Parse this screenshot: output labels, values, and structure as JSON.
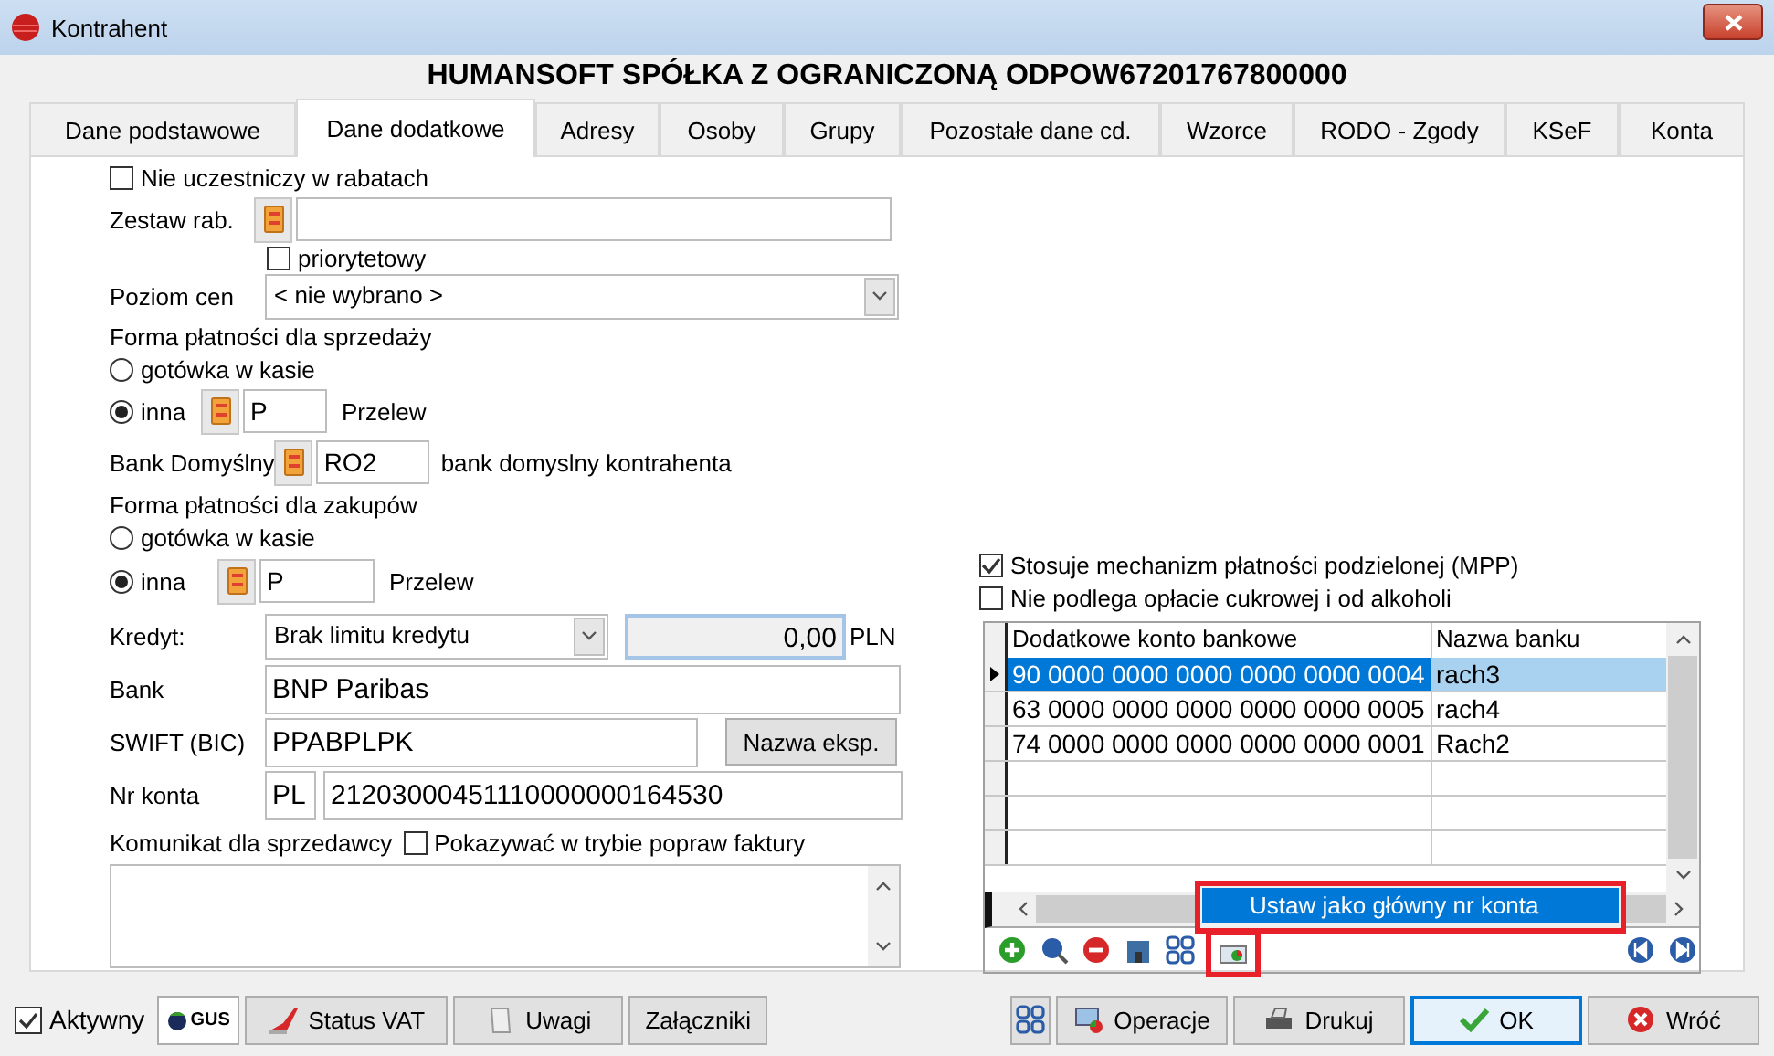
{
  "window": {
    "title": "Kontrahent"
  },
  "heading": "HUMANSOFT SPÓŁKA Z OGRANICZONĄ ODPOW67201767800000",
  "tabs": [
    {
      "label": "Dane podstawowe",
      "selected": false
    },
    {
      "label": "Dane dodatkowe",
      "selected": true
    },
    {
      "label": "Adresy",
      "selected": false
    },
    {
      "label": "Osoby",
      "selected": false
    },
    {
      "label": "Grupy",
      "selected": false
    },
    {
      "label": "Pozostałe dane cd.",
      "selected": false
    },
    {
      "label": "Wzorce",
      "selected": false
    },
    {
      "label": "RODO - Zgody",
      "selected": false
    },
    {
      "label": "KSeF",
      "selected": false
    },
    {
      "label": "Konta",
      "selected": false
    }
  ],
  "discount": {
    "exclude": {
      "label": "Nie uczestniczy w rabatach",
      "checked": false
    },
    "set_label": "Zestaw rab.",
    "priority": {
      "label": "priorytetowy",
      "checked": false
    }
  },
  "price_level": {
    "label": "Poziom cen",
    "value": "< nie wybrano >"
  },
  "sales_payment": {
    "title": "Forma płatności dla sprzedaży",
    "options": [
      {
        "label": "gotówka w kasie",
        "selected": false
      },
      {
        "label": "inna",
        "selected": true
      }
    ],
    "code": "P",
    "name": "Przelew"
  },
  "default_bank": {
    "label": "Bank Domyślny",
    "code": "RO2",
    "description": "bank domyslny kontrahenta"
  },
  "purchase_payment": {
    "title": "Forma płatności dla zakupów",
    "options": [
      {
        "label": "gotówka w kasie",
        "selected": false
      },
      {
        "label": "inna",
        "selected": true
      }
    ],
    "code": "P",
    "name": "Przelew"
  },
  "credit": {
    "label": "Kredyt:",
    "value": "Brak limitu kredytu",
    "amount": "0,00",
    "currency": "PLN"
  },
  "bank": {
    "label": "Bank",
    "value": "BNP Paribas"
  },
  "swift": {
    "label": "SWIFT (BIC)",
    "value": "PPABPLPK",
    "button": "Nazwa eksp."
  },
  "account": {
    "label": "Nr konta",
    "country": "PL",
    "number": "21203000451110000000164530"
  },
  "message": {
    "label": "Komunikat dla sprzedawcy",
    "show_in_correction": {
      "label": "Pokazywać w trybie popraw faktury",
      "checked": false
    }
  },
  "options": [
    {
      "label": "Stosuje mechanizm płatności podzielonej (MPP)",
      "checked": true
    },
    {
      "label": "Nie podlega opłacie cukrowej i od alkoholi",
      "checked": false
    }
  ],
  "accounts_table": {
    "columns": [
      "Dodatkowe konto bankowe",
      "Nazwa banku"
    ],
    "rows": [
      {
        "account": "90 0000 0000 0000 0000 0000 0004",
        "bank": "rach3",
        "selected": true
      },
      {
        "account": "63 0000 0000 0000 0000 0000 0005",
        "bank": "rach4",
        "selected": false
      },
      {
        "account": "74 0000 0000 0000 0000 0000 0001",
        "bank": "Rach2",
        "selected": false
      }
    ]
  },
  "context_menu": {
    "items": [
      "Ustaw jako główny nr konta"
    ]
  },
  "bottom_bar": {
    "active": {
      "label": "Aktywny",
      "checked": true
    },
    "left_buttons": [
      {
        "kind": "gus",
        "label": "GUS"
      },
      {
        "kind": "vat",
        "label": "Status VAT"
      },
      {
        "kind": "notes",
        "label": "Uwagi"
      },
      {
        "kind": "plain",
        "label": "Załączniki"
      }
    ],
    "right_buttons": [
      {
        "kind": "chain"
      },
      {
        "kind": "operations",
        "label": "Operacje"
      },
      {
        "kind": "print",
        "label": "Drukuj"
      },
      {
        "kind": "ok",
        "label": "OK"
      },
      {
        "kind": "back",
        "label": "Wróć"
      }
    ]
  }
}
